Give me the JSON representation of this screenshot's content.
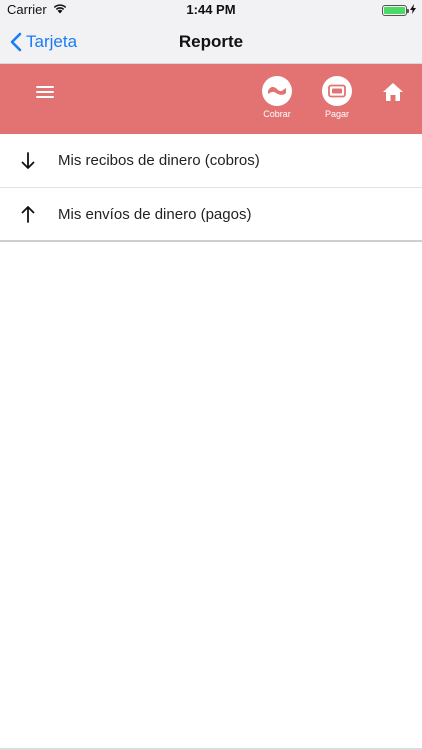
{
  "status_bar": {
    "carrier": "Carrier",
    "time": "1:44 PM"
  },
  "nav": {
    "back_label": "Tarjeta",
    "title": "Reporte"
  },
  "toolbar": {
    "menu_icon": "menu-icon",
    "cobrar_label": "Cobrar",
    "pagar_label": "Pagar",
    "home_icon": "home-icon"
  },
  "report": {
    "items": [
      {
        "icon": "arrow-down-icon",
        "label": "Mis recibos de dinero (cobros)"
      },
      {
        "icon": "arrow-up-icon",
        "label": "Mis envíos de dinero (pagos)"
      }
    ]
  },
  "colors": {
    "toolbar_bg": "#e37373",
    "link_blue": "#1a7cf5"
  }
}
